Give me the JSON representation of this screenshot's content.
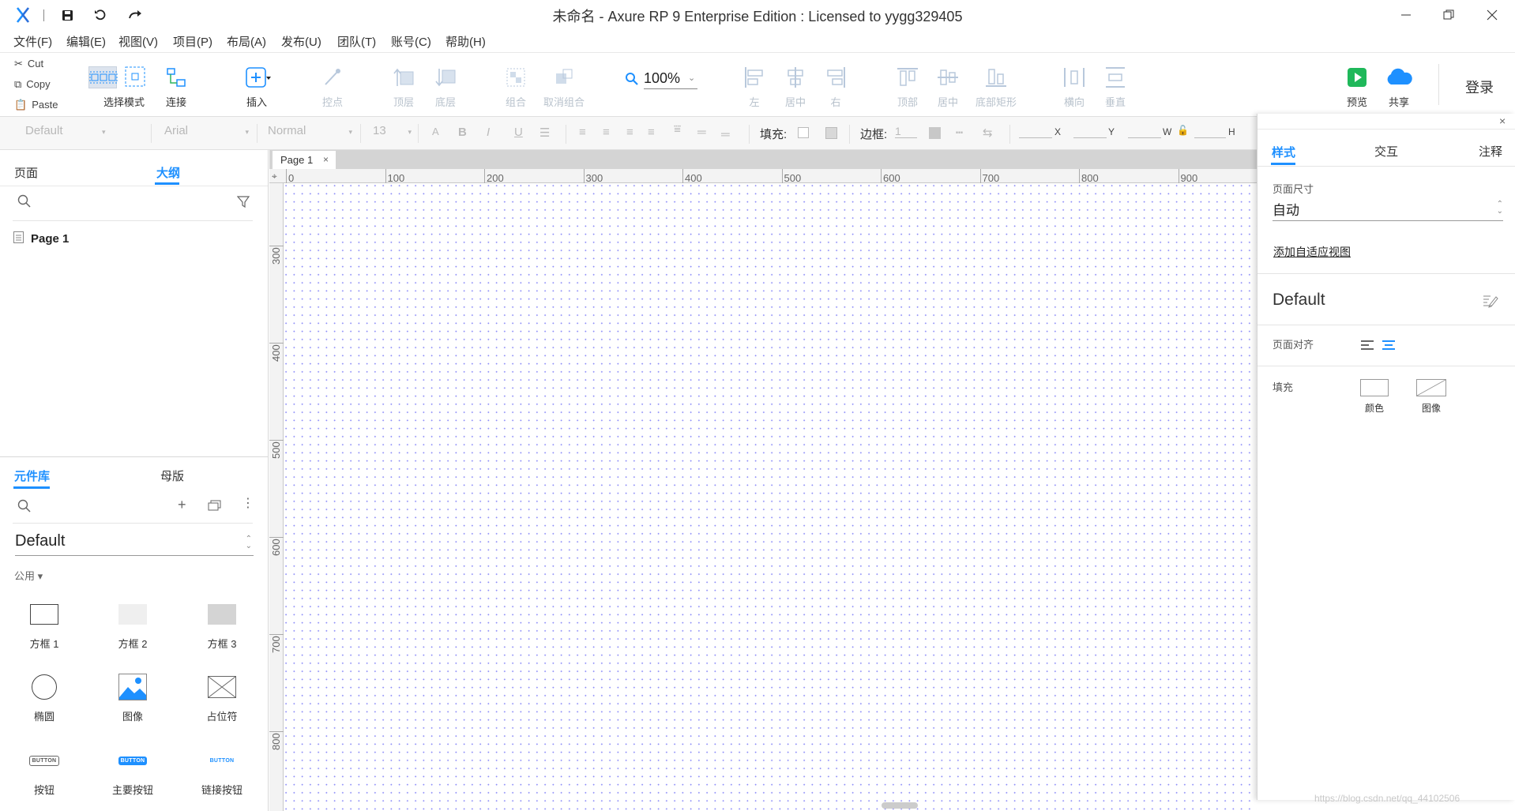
{
  "app": {
    "title": "未命名 - Axure RP 9 Enterprise Edition : Licensed to yygg329405",
    "accent": "#1e90ff"
  },
  "menu": [
    "文件(F)",
    "编辑(E)",
    "视图(V)",
    "项目(P)",
    "布局(A)",
    "发布(U)",
    "团队(T)",
    "账号(C)",
    "帮助(H)"
  ],
  "clipboard": {
    "cut": "Cut",
    "copy": "Copy",
    "paste": "Paste"
  },
  "toolbar": {
    "select_mode": "选择模式",
    "connect": "连接",
    "insert": "插入",
    "points": "控点",
    "top_layer": "顶层",
    "bottom_layer": "底层",
    "group": "组合",
    "ungroup": "取消组合",
    "zoom": "100%",
    "align_left": "左",
    "align_center": "居中",
    "align_right": "右",
    "align_top": "顶部",
    "align_middle": "居中",
    "align_bottom": "底部矩形",
    "dist_h": "横向",
    "dist_v": "垂直",
    "preview": "预览",
    "share": "共享",
    "login": "登录"
  },
  "format": {
    "style": "Default",
    "font": "Arial",
    "weight": "Normal",
    "size": "13",
    "fill_label": "填充:",
    "border_label": "边框:",
    "border_width": "1",
    "x": "X",
    "y": "Y",
    "w": "W",
    "h": "H"
  },
  "left_panel": {
    "tab_pages": "页面",
    "tab_outline": "大纲",
    "page_item": "Page 1",
    "tab_library": "元件库",
    "tab_masters": "母版",
    "library_name": "Default",
    "category": "公用 ▾",
    "widgets": [
      "方框 1",
      "方框 2",
      "方框 3",
      "椭圆",
      "图像",
      "占位符",
      "按钮",
      "主要按钮",
      "链接按钮"
    ],
    "button_text": "BUTTON"
  },
  "canvas": {
    "tab": "Page 1",
    "hticks": [
      "0",
      "100",
      "200",
      "300",
      "400",
      "500",
      "600",
      "700",
      "800",
      "900"
    ],
    "vticks": [
      "300",
      "400",
      "500",
      "600",
      "700",
      "800"
    ]
  },
  "right_panel": {
    "tab_style": "样式",
    "tab_interact": "交互",
    "tab_notes": "注释",
    "page_size_label": "页面尺寸",
    "page_size_value": "自动",
    "adaptive_link": "添加自适应视图",
    "style_name": "Default",
    "page_align_label": "页面对齐",
    "fill_label": "填充",
    "fill_color": "颜色",
    "fill_image": "图像"
  },
  "watermark": "https://blog.csdn.net/qq_44102506"
}
